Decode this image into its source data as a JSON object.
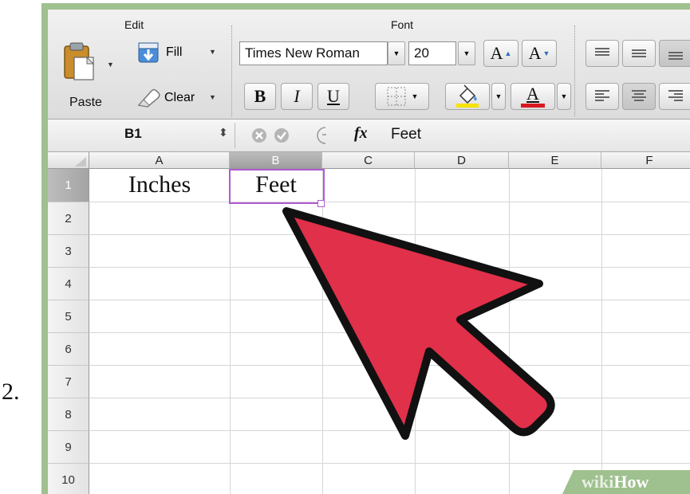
{
  "step_number": "2.",
  "ribbon": {
    "edit_group": {
      "title": "Edit",
      "paste_label": "Paste",
      "fill_label": "Fill",
      "clear_label": "Clear"
    },
    "font_group": {
      "title": "Font",
      "font_name": "Times New Roman",
      "font_size": "20",
      "grow_font": "A",
      "shrink_font": "A",
      "bold": "B",
      "italic": "I",
      "underline": "U",
      "font_color_letter": "A",
      "highlight_color": "#f5e300",
      "font_color": "#d9181f"
    }
  },
  "formula_bar": {
    "name_box": "B1",
    "fx_label": "fx",
    "content": "Feet"
  },
  "grid": {
    "columns": [
      "A",
      "B",
      "C",
      "D",
      "E",
      "F"
    ],
    "rows": [
      "1",
      "2",
      "3",
      "4",
      "5",
      "6",
      "7",
      "8",
      "9",
      "10"
    ],
    "selected_cell": "B1",
    "cells": {
      "A1": "Inches",
      "B1": "Feet"
    }
  },
  "overlay": {
    "arrow_color": "#e0304a"
  },
  "watermark": {
    "part1": "wiki",
    "part2": "How"
  }
}
